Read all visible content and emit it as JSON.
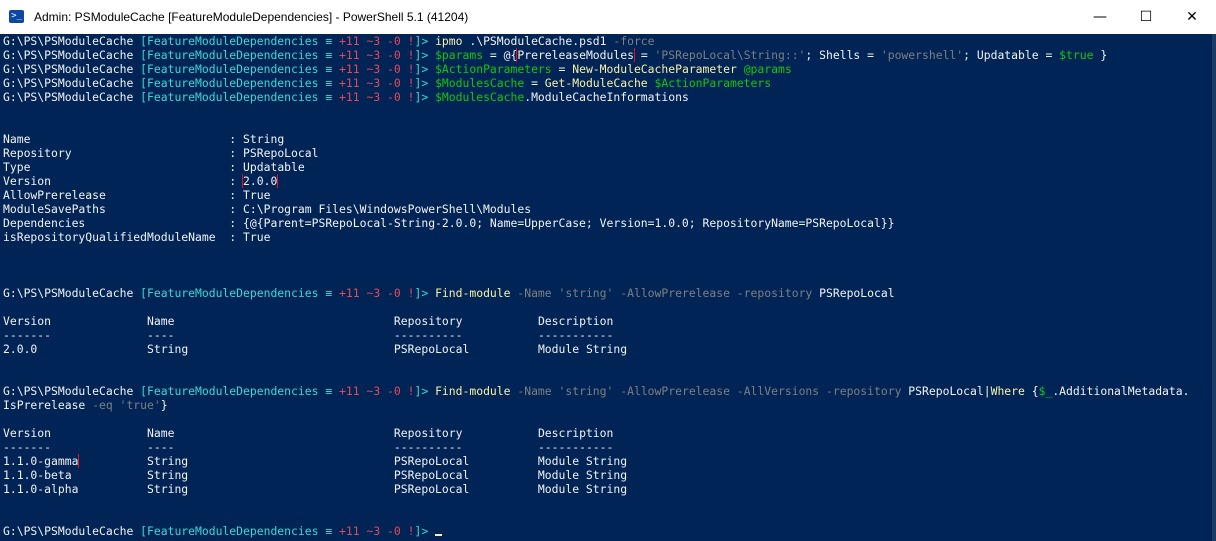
{
  "window": {
    "title": "Admin: PSModuleCache [FeatureModuleDependencies] - PowerShell 5.1 (41204)",
    "icon": "powershell-icon",
    "minimize": "—",
    "maximize": "☐",
    "close": "✕"
  },
  "prompt": {
    "path": "G:\\PS\\PSModuleCache ",
    "branch": "[FeatureModuleDependencies",
    "status_sep": " ≡ ",
    "status": "+11 ~3 -0 !",
    "end": "]> "
  },
  "commands": {
    "c1": [
      "ipmo",
      " .\\PSModuleCache.psd1 ",
      "-force"
    ],
    "c2": [
      "$params",
      " = ",
      "@{",
      "PrereleaseModules",
      " = ",
      "'PSRepoLocal\\String::'",
      "; Shells = ",
      "'powershell'",
      "; Updatable = ",
      "$true",
      " }"
    ],
    "c3": [
      "$ActionParameters",
      " = ",
      "New-ModuleCacheParameter",
      " ",
      "@params"
    ],
    "c4": [
      "$ModulesCache",
      " = ",
      "Get-ModuleCache",
      " ",
      "$ActionParameters"
    ],
    "c5": [
      "$ModulesCache",
      ".ModuleCacheInformations"
    ],
    "c6": [
      "Find-module",
      " ",
      "-Name",
      " ",
      "'string'",
      " ",
      "-AllowPrerelease",
      " ",
      "-repository",
      " PSRepoLocal"
    ],
    "c7a": [
      "Find-module",
      " ",
      "-Name",
      " ",
      "'string'",
      " ",
      "-AllowPrerelease",
      " ",
      "-AllVersions",
      " ",
      "-repository",
      " PSRepoLocal|",
      "Where",
      " {",
      "$_",
      ".AdditionalMetadata."
    ],
    "c7b": [
      "IsPrerelease",
      " ",
      "-eq",
      " ",
      "'true'",
      "}"
    ]
  },
  "info": [
    {
      "key": "Name",
      "sep": " : ",
      "value": "String"
    },
    {
      "key": "Repository",
      "sep": " : ",
      "value": "PSRepoLocal"
    },
    {
      "key": "Type",
      "sep": " : ",
      "value": "Updatable"
    },
    {
      "key": "Version",
      "sep": " : ",
      "value": "2.0.0"
    },
    {
      "key": "AllowPrerelease",
      "sep": " : ",
      "value": "True"
    },
    {
      "key": "ModuleSavePaths",
      "sep": " : ",
      "value": "C:\\Program Files\\WindowsPowerShell\\Modules"
    },
    {
      "key": "Dependencies",
      "sep": " : ",
      "value": "{@{Parent=PSRepoLocal-String-2.0.0; Name=UpperCase; Version=1.0.0; RepositoryName=PSRepoLocal}}"
    },
    {
      "key": "isRepositoryQualifiedModuleName",
      "sep": " : ",
      "value": "True"
    }
  ],
  "table_headers": [
    "Version",
    "Name",
    "Repository",
    "Description"
  ],
  "table_rules": [
    "-------",
    "----",
    "----------",
    "-----------"
  ],
  "table1": [
    [
      "2.0.0",
      "String",
      "PSRepoLocal",
      "Module String"
    ]
  ],
  "table2": [
    [
      "1.1.0-gamma",
      "String",
      "PSRepoLocal",
      "Module String"
    ],
    [
      "1.1.0-beta",
      "String",
      "PSRepoLocal",
      "Module String"
    ],
    [
      "1.1.0-alpha",
      "String",
      "PSRepoLocal",
      "Module String"
    ]
  ]
}
